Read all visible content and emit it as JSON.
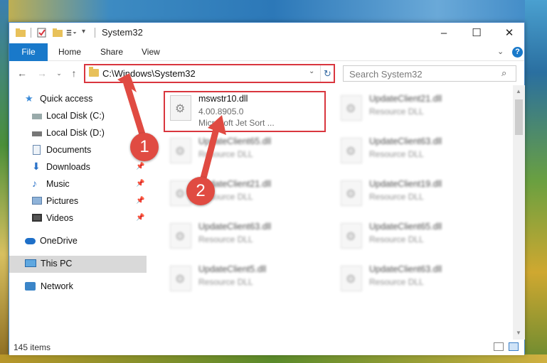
{
  "window": {
    "title": "System32"
  },
  "ribbon": {
    "file": "File",
    "home": "Home",
    "share": "Share",
    "view": "View"
  },
  "address": {
    "path": "C:\\Windows\\System32"
  },
  "search": {
    "placeholder": "Search System32"
  },
  "nav": {
    "items": [
      {
        "label": "Quick access",
        "icon": "star-icon"
      },
      {
        "label": "Local Disk (C:)",
        "icon": "drive-icon"
      },
      {
        "label": "Local Disk (D:)",
        "icon": "drive-icon"
      },
      {
        "label": "Documents",
        "icon": "documents-icon"
      },
      {
        "label": "Downloads",
        "icon": "download-icon"
      },
      {
        "label": "Music",
        "icon": "music-icon"
      },
      {
        "label": "Pictures",
        "icon": "pictures-icon"
      },
      {
        "label": "Videos",
        "icon": "videos-icon"
      },
      {
        "label": "OneDrive",
        "icon": "cloud-icon"
      },
      {
        "label": "This PC",
        "icon": "computer-icon"
      },
      {
        "label": "Network",
        "icon": "network-icon"
      }
    ]
  },
  "files": {
    "main": {
      "name": "mswstr10.dll",
      "version": "4.00.8905.0",
      "desc": "Microsoft Jet Sort ..."
    },
    "blurred": [
      {
        "name": "UpdateClient21.dll",
        "type": "Resource DLL"
      },
      {
        "name": "UpdateClient65.dll",
        "type": "Resource DLL"
      },
      {
        "name": "UpdateClient63.dll",
        "type": "Resource DLL"
      },
      {
        "name": "UpdateClient21.dll",
        "type": "Resource DLL"
      },
      {
        "name": "UpdateClient19.dll",
        "type": "Resource DLL"
      },
      {
        "name": "UpdateClient63.dll",
        "type": "Resource DLL"
      },
      {
        "name": "UpdateClient65.dll",
        "type": "Resource DLL"
      },
      {
        "name": "UpdateClient5.dll",
        "type": "Resource DLL"
      },
      {
        "name": "UpdateClient63.dll",
        "type": "Resource DLL"
      }
    ]
  },
  "status": {
    "count": "145 items"
  },
  "annotations": {
    "one": "1",
    "two": "2"
  },
  "colors": {
    "accent": "#1979ca",
    "highlight": "#d9363e",
    "badge": "#e04b42"
  }
}
